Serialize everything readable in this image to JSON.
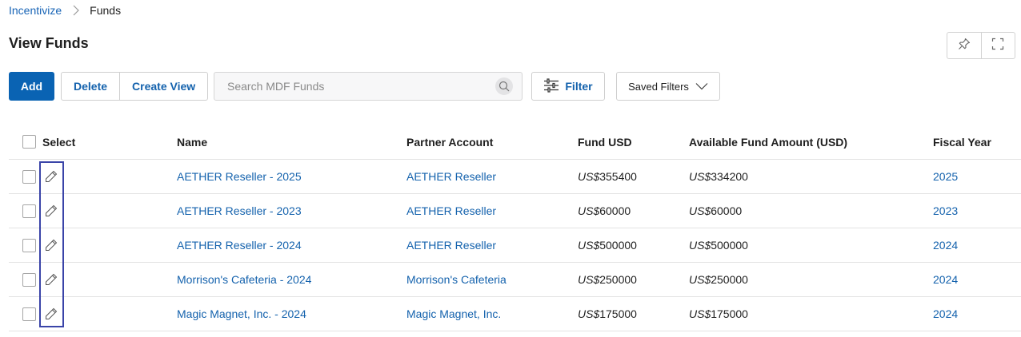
{
  "breadcrumb": {
    "root": "Incentivize",
    "current": "Funds"
  },
  "page": {
    "title": "View Funds"
  },
  "top_actions": {
    "pin_icon": "pin-icon",
    "expand_icon": "fullscreen-icon"
  },
  "toolbar": {
    "add_label": "Add",
    "delete_label": "Delete",
    "create_view_label": "Create View",
    "search_placeholder": "Search MDF Funds",
    "filter_label": "Filter",
    "saved_filters_label": "Saved Filters"
  },
  "table": {
    "columns": [
      "Select",
      "Name",
      "Partner Account",
      "Fund USD",
      "Available Fund Amount (USD)",
      "Fiscal Year"
    ],
    "currency_prefix": "US$",
    "rows": [
      {
        "name": "AETHER Reseller - 2025",
        "partner": "AETHER Reseller",
        "fund": "355400",
        "available": "334200",
        "year": "2025"
      },
      {
        "name": "AETHER Reseller - 2023",
        "partner": "AETHER Reseller",
        "fund": "60000",
        "available": "60000",
        "year": "2023"
      },
      {
        "name": "AETHER Reseller - 2024",
        "partner": "AETHER Reseller",
        "fund": "500000",
        "available": "500000",
        "year": "2024"
      },
      {
        "name": "Morrison's Cafeteria - 2024",
        "partner": "Morrison's Cafeteria",
        "fund": "250000",
        "available": "250000",
        "year": "2024"
      },
      {
        "name": "Magic Magnet, Inc. - 2024",
        "partner": "Magic Magnet, Inc.",
        "fund": "175000",
        "available": "175000",
        "year": "2024"
      }
    ]
  },
  "colors": {
    "accent": "#0a63b3",
    "link": "#1462ad",
    "highlight": "#3a44a8"
  }
}
